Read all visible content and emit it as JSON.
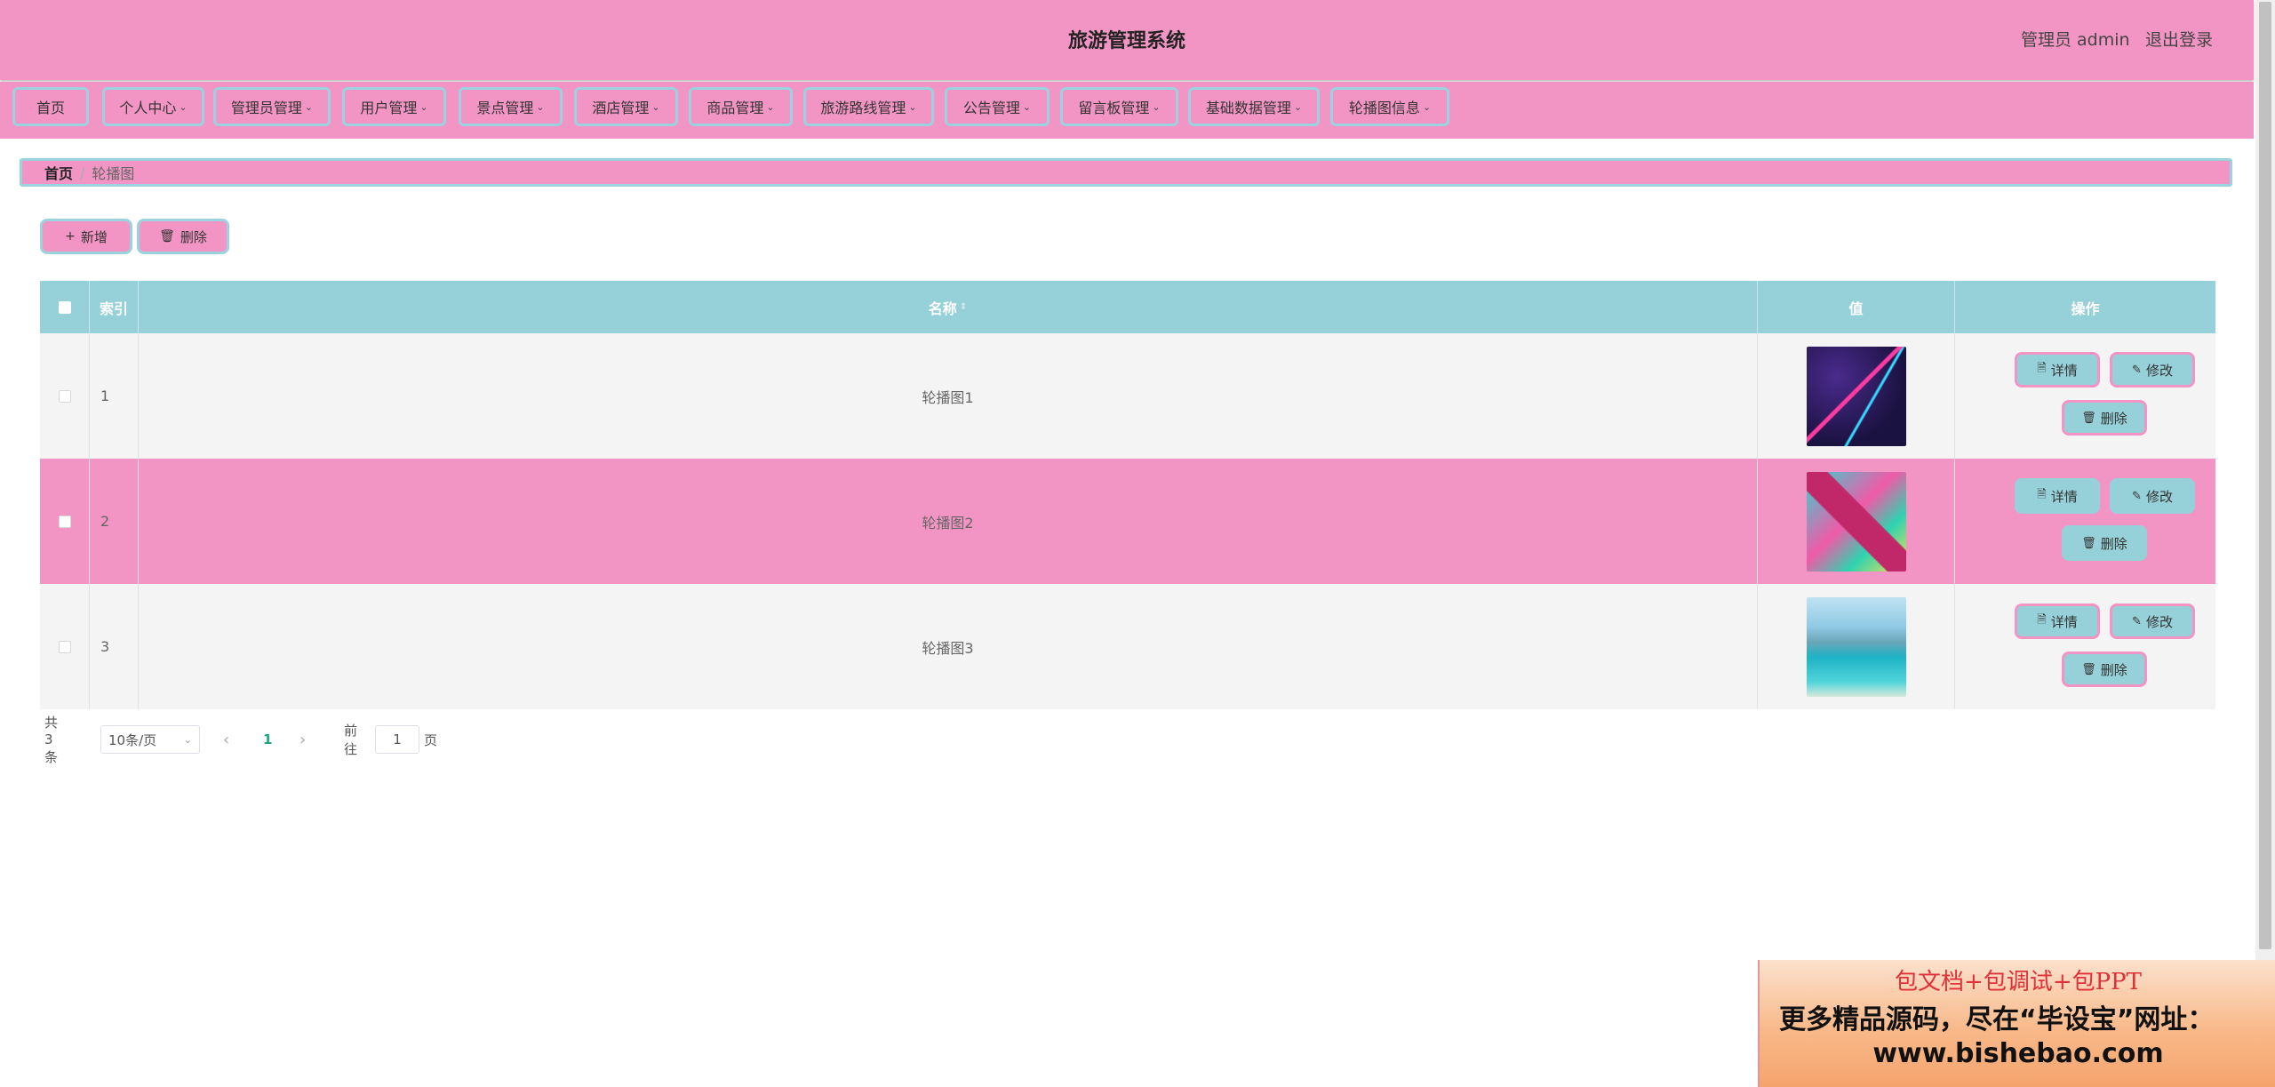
{
  "header": {
    "title": "旅游管理系统",
    "user_label": "管理员 admin",
    "logout_label": "退出登录"
  },
  "nav": {
    "items": [
      {
        "label": "首页",
        "has_dropdown": false
      },
      {
        "label": "个人中心",
        "has_dropdown": true
      },
      {
        "label": "管理员管理",
        "has_dropdown": true
      },
      {
        "label": "用户管理",
        "has_dropdown": true
      },
      {
        "label": "景点管理",
        "has_dropdown": true
      },
      {
        "label": "酒店管理",
        "has_dropdown": true
      },
      {
        "label": "商品管理",
        "has_dropdown": true
      },
      {
        "label": "旅游路线管理",
        "has_dropdown": true
      },
      {
        "label": "公告管理",
        "has_dropdown": true
      },
      {
        "label": "留言板管理",
        "has_dropdown": true
      },
      {
        "label": "基础数据管理",
        "has_dropdown": true
      },
      {
        "label": "轮播图信息",
        "has_dropdown": true
      }
    ]
  },
  "breadcrumb": {
    "home": "首页",
    "separator": "/",
    "current": "轮播图"
  },
  "toolbar": {
    "add_label": "新增",
    "delete_label": "删除"
  },
  "table": {
    "columns": {
      "index": "索引",
      "name": "名称",
      "value": "值",
      "actions": "操作"
    },
    "rows": [
      {
        "index": "1",
        "name": "轮播图1",
        "thumb": "abstract-purple-image"
      },
      {
        "index": "2",
        "name": "轮播图2",
        "thumb": "colorful-star-image"
      },
      {
        "index": "3",
        "name": "轮播图3",
        "thumb": "beach-image"
      }
    ],
    "actions": {
      "detail": "详情",
      "edit": "修改",
      "delete": "删除"
    }
  },
  "pagination": {
    "total": "共 3 条",
    "page_size": "10条/页",
    "current_page": "1",
    "goto_label": "前往",
    "goto_value": "1",
    "page_suffix": "页"
  },
  "banner": {
    "line1": "包文档+包调试+包PPT",
    "line2": "更多精品源码，尽在“毕设宝”网址：",
    "line3": "www.bishebao.com"
  },
  "colors": {
    "pink": "#f295c5",
    "teal": "#96d0d8",
    "active_page": "#1aa77f"
  }
}
